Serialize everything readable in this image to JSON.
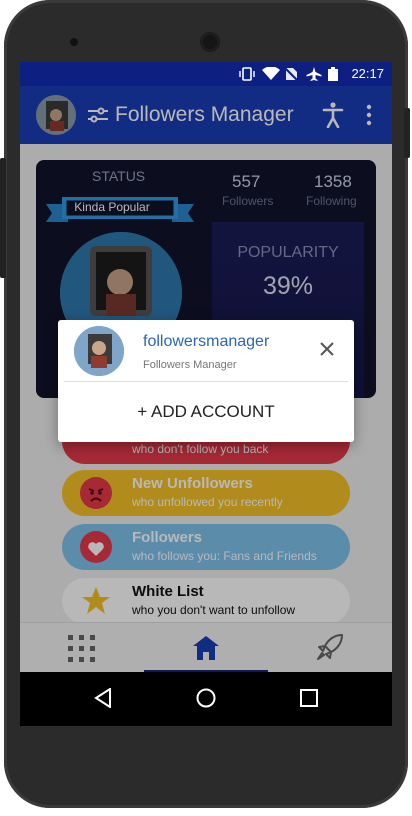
{
  "status_bar": {
    "time": "22:17"
  },
  "app_bar": {
    "title": "Followers Manager"
  },
  "stats": {
    "status_label": "STATUS",
    "status_badge": "Kinda Popular",
    "followers_count": "557",
    "followers_label": "Followers",
    "following_count": "1358",
    "following_label": "Following",
    "popularity_label": "POPULARITY",
    "popularity_value": "39%"
  },
  "menu": [
    {
      "title": "",
      "subtitle": "who don't follow you back",
      "color": "#e8394b"
    },
    {
      "title": "New Unfollowers",
      "subtitle": "who unfollowed you recently",
      "color": "#f5c227"
    },
    {
      "title": "Followers",
      "subtitle": "who follows you: Fans and Friends",
      "color": "#7ec4ec"
    },
    {
      "title": "White List",
      "subtitle": "who you don't want to unfollow",
      "color": "#ffffff"
    }
  ],
  "dialog": {
    "username": "followersmanager",
    "subtitle": "Followers Manager",
    "add_account": "+ ADD ACCOUNT"
  },
  "colors": {
    "appbar": "#1a3eb8",
    "statusbar": "#0d1f80",
    "accent": "#1a237e"
  }
}
